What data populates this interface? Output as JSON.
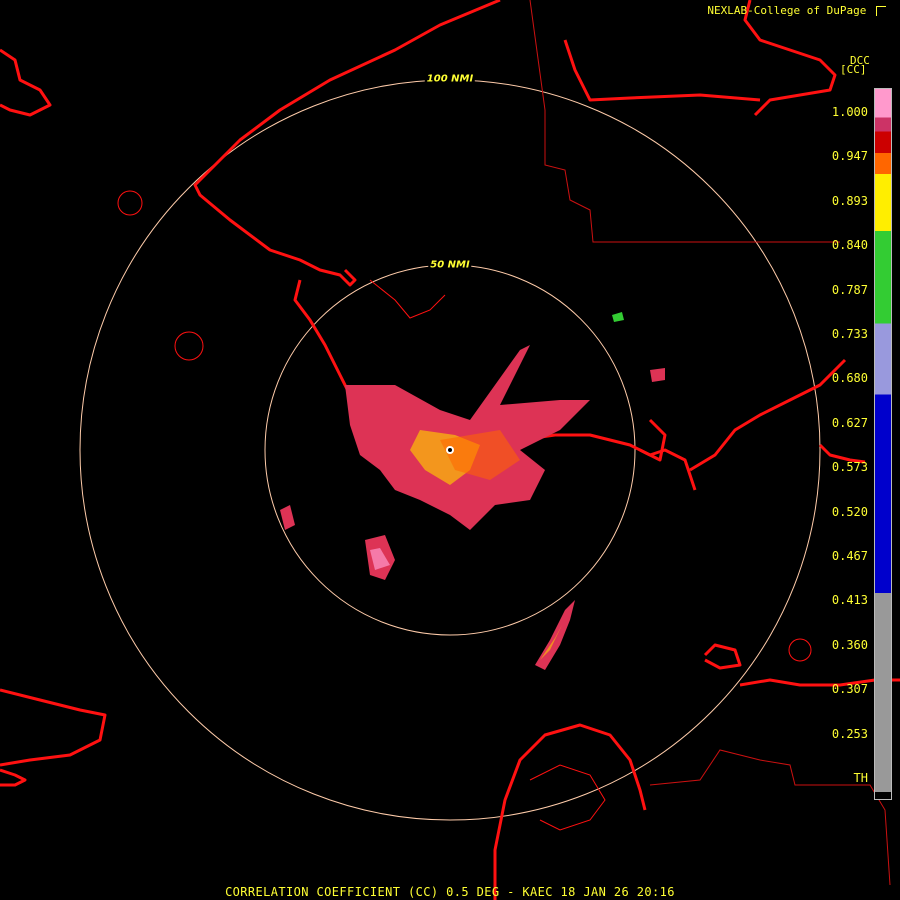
{
  "header": {
    "source": "NEXLAB-College of DuPage",
    "logo_icon": "cod-corner-logo-icon"
  },
  "product": {
    "code": "DCC",
    "unit": "[CC]"
  },
  "footer": {
    "caption": "CORRELATION COEFFICIENT (CC) 0.5 DEG - KAEC 18 JAN 26 20:16"
  },
  "range_rings": [
    {
      "label": "100 NMI"
    },
    {
      "label": "50 NMI"
    }
  ],
  "colorbar": {
    "ticks": [
      "1.000",
      "0.947",
      "0.893",
      "0.840",
      "0.787",
      "0.733",
      "0.680",
      "0.627",
      "0.573",
      "0.520",
      "0.467",
      "0.413",
      "0.360",
      "0.307",
      "0.253",
      "TH"
    ],
    "colors": {
      "pink": "#ff99cc",
      "magenta": "#cc3366",
      "red": "#cc0000",
      "orange": "#ff6600",
      "yellow": "#ffee00",
      "green": "#33cc33",
      "lavender": "#9999dd",
      "blue": "#0000cc",
      "gray": "#999999"
    }
  },
  "map_colors": {
    "coastline": "#ff1111",
    "boundary": "#cc1111",
    "ring": "#ffccaa",
    "echo_core": "#dd3355",
    "echo_edge": "#ffcc00"
  }
}
